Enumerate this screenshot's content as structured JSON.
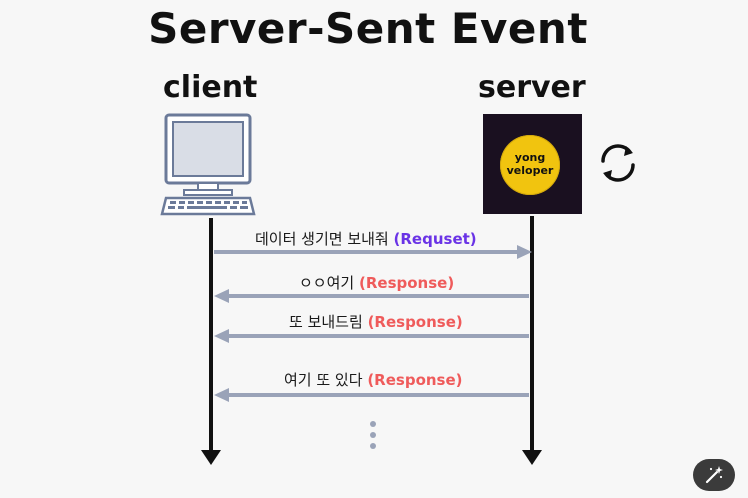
{
  "title": "Server-Sent Event",
  "actors": {
    "client": "client",
    "server": "server"
  },
  "logo": {
    "line1": "yong",
    "line2": "veloper"
  },
  "messages": [
    {
      "text": "데이터 생기면 보내줘",
      "tag": "(Requset)",
      "direction": "client-to-server"
    },
    {
      "text": "ㅇㅇ여기",
      "tag": "(Response)",
      "direction": "server-to-client"
    },
    {
      "text": "또 보내드림",
      "tag": "(Response)",
      "direction": "server-to-client"
    },
    {
      "text": "여기  또 있다",
      "tag": "(Response)",
      "direction": "server-to-client"
    }
  ],
  "colors": {
    "request_tag": "#6a33e6",
    "response_tag": "#ef5b5b",
    "arrow": "#9aa3b8",
    "lifeline": "#111111",
    "logo_bg": "#1a1020",
    "logo_circle": "#f1c40f"
  },
  "icons": {
    "client": "computer-icon",
    "refresh": "refresh-icon",
    "more": "vertical-ellipsis-icon",
    "magic": "magic-wand-icon"
  }
}
